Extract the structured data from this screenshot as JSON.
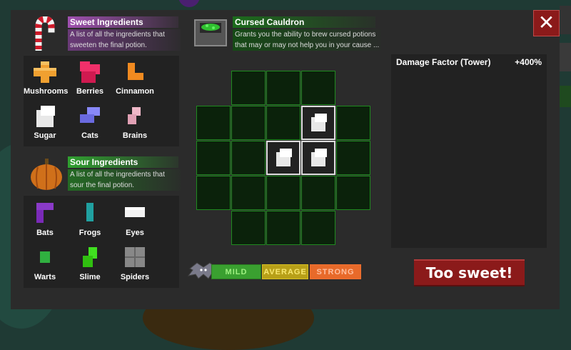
{
  "sweet": {
    "title": "Sweet Ingredients",
    "description": "A list of all the ingredients that sweeten the final potion.",
    "items": [
      {
        "label": "Mushrooms",
        "color": "#f0a030",
        "shape": "plus"
      },
      {
        "label": "Berries",
        "color": "#f0306a",
        "shape": "blob"
      },
      {
        "label": "Cinnamon",
        "color": "#f08a20",
        "shape": "corner"
      },
      {
        "label": "Sugar",
        "color": "#f2f2f2",
        "shape": "cube"
      },
      {
        "label": "Cats",
        "color": "#7878f0",
        "shape": "zig"
      },
      {
        "label": "Brains",
        "color": "#f0b8c8",
        "shape": "smallzig"
      }
    ]
  },
  "sour": {
    "title": "Sour Ingredients",
    "description": "A list of all the ingredients that sour the final potion.",
    "items": [
      {
        "label": "Bats",
        "color": "#7a2ab8",
        "shape": "ell"
      },
      {
        "label": "Frogs",
        "color": "#20a0a0",
        "shape": "bar"
      },
      {
        "label": "Eyes",
        "color": "#f2f2f2",
        "shape": "flat"
      },
      {
        "label": "Warts",
        "color": "#30b040",
        "shape": "small"
      },
      {
        "label": "Slime",
        "color": "#40e020",
        "shape": "slime"
      },
      {
        "label": "Spiders",
        "color": "#888888",
        "shape": "square"
      }
    ]
  },
  "cauldron": {
    "title": "Cursed Cauldron",
    "description": "Grants you the ability to brew cursed potions that may or may not help you in your cause ..."
  },
  "meter": {
    "mild": "MILD",
    "average": "AVERAGE",
    "strong": "STRONG"
  },
  "stats": {
    "label": "Damage Factor (Tower)",
    "value": "+400%"
  },
  "result_button": "Too sweet!",
  "close_glyph": "✕",
  "colors": {
    "sweet_header": "#a050b0",
    "sour_header": "#30a030",
    "cauldron_header": "#1c6b1c",
    "grid_border": "#1f8a1f",
    "mild": "#3aa030",
    "average": "#d8c020",
    "strong": "#f07030",
    "result": "#8b1a1a"
  }
}
